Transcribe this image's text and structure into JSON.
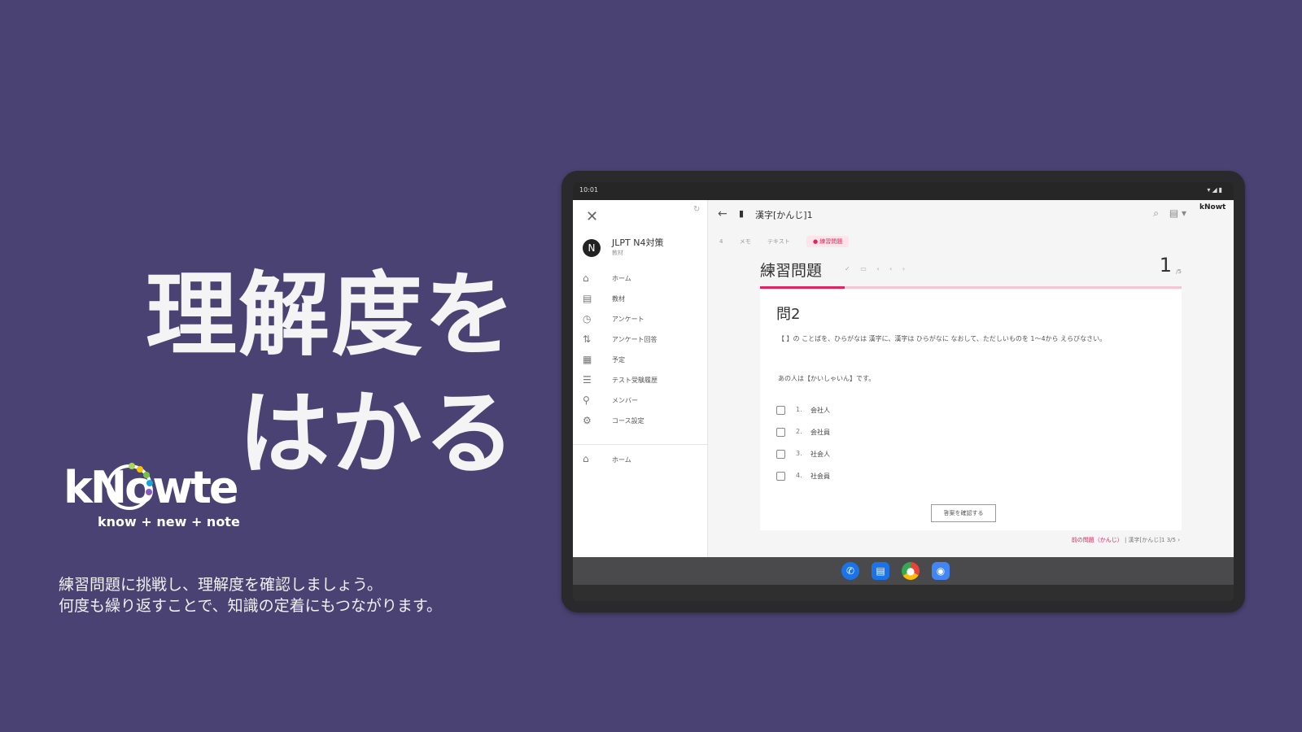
{
  "headline": {
    "line1": "理解度を",
    "line2": "はかる"
  },
  "logo": {
    "wordmark": "kNowte",
    "tagline": "know + new + note"
  },
  "description": {
    "line1": "練習問題に挑戦し、理解度を確認しましょう。",
    "line2": "何度も繰り返すことで、知識の定着にもつながります。"
  },
  "tablet": {
    "status": {
      "time": "10:01",
      "icons": "▾◢▮"
    },
    "drawer": {
      "course_title": "JLPT N4対策",
      "course_sub": "教材",
      "items": [
        {
          "label": "ホーム",
          "icon": "home-icon"
        },
        {
          "label": "教材",
          "icon": "book-icon"
        },
        {
          "label": "アンケート",
          "icon": "clock-icon"
        },
        {
          "label": "アンケート回答",
          "icon": "sort-icon"
        },
        {
          "label": "予定",
          "icon": "calendar-icon"
        },
        {
          "label": "テスト受験履歴",
          "icon": "list-icon"
        },
        {
          "label": "メンバー",
          "icon": "person-icon"
        },
        {
          "label": "コース設定",
          "icon": "gear-icon"
        }
      ],
      "bottom_item": {
        "label": "ホーム",
        "icon": "home-icon"
      }
    },
    "topbar": {
      "title": "漢字[かんじ]1",
      "logo_text": "kNowt"
    },
    "crumbs": {
      "item1": "4",
      "item2": "メモ",
      "item3": "テキスト",
      "pill": "● 練習問題"
    },
    "quiz": {
      "heading": "練習問題",
      "tools": "✓ ▭ ‹ ‹ ›",
      "count": "1",
      "count_unit": "/5",
      "progress": 0.2,
      "question_title": "問2",
      "instruction": "【 】の ことばを、ひらがなは 漢字に、漢字は ひらがなに なおして、ただしいものを 1〜4から えらびなさい。",
      "sentence": "あの人は【かいしゃいん】です。",
      "options": [
        {
          "num": "1.",
          "text": "会社人"
        },
        {
          "num": "2.",
          "text": "会社員"
        },
        {
          "num": "3.",
          "text": "社会人"
        },
        {
          "num": "4.",
          "text": "社会員"
        }
      ],
      "submit_label": "答案を確認する"
    },
    "footnote": {
      "link": "前の問題（かんじ）",
      "rest": " | 漢字[かんじ]1 3/5 ›"
    }
  },
  "colors": {
    "background": "#4b4274",
    "accent": "#e0235f"
  }
}
